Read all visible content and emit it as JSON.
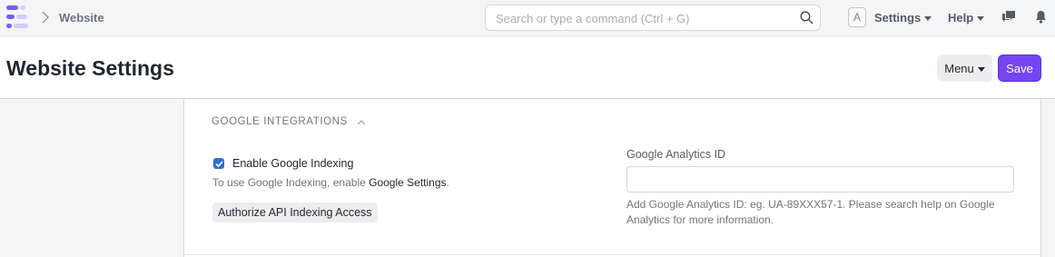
{
  "navbar": {
    "breadcrumb": "Website",
    "search": {
      "placeholder": "Search or type a command (Ctrl + G)"
    },
    "avatar_initial": "A",
    "settings_label": "Settings",
    "help_label": "Help",
    "icons": [
      "app-logo-icon",
      "chevron-right-icon",
      "search-icon",
      "chat-icon",
      "bell-icon"
    ]
  },
  "page": {
    "title": "Website Settings",
    "menu_label": "Menu",
    "save_label": "Save",
    "accent_color": "#7445f3"
  },
  "section": {
    "title": "GOOGLE INTEGRATIONS",
    "enable_indexing": {
      "label": "Enable Google Indexing",
      "checked": true
    },
    "indexing_help": {
      "prefix": "To use Google Indexing, enable ",
      "link": "Google Settings",
      "suffix": "."
    },
    "authorize_button": "Authorize API Indexing Access",
    "analytics": {
      "label": "Google Analytics ID",
      "value": "",
      "description": "Add Google Analytics ID: eg. UA-89XXX57-1. Please search help on Google Analytics for more information."
    }
  }
}
